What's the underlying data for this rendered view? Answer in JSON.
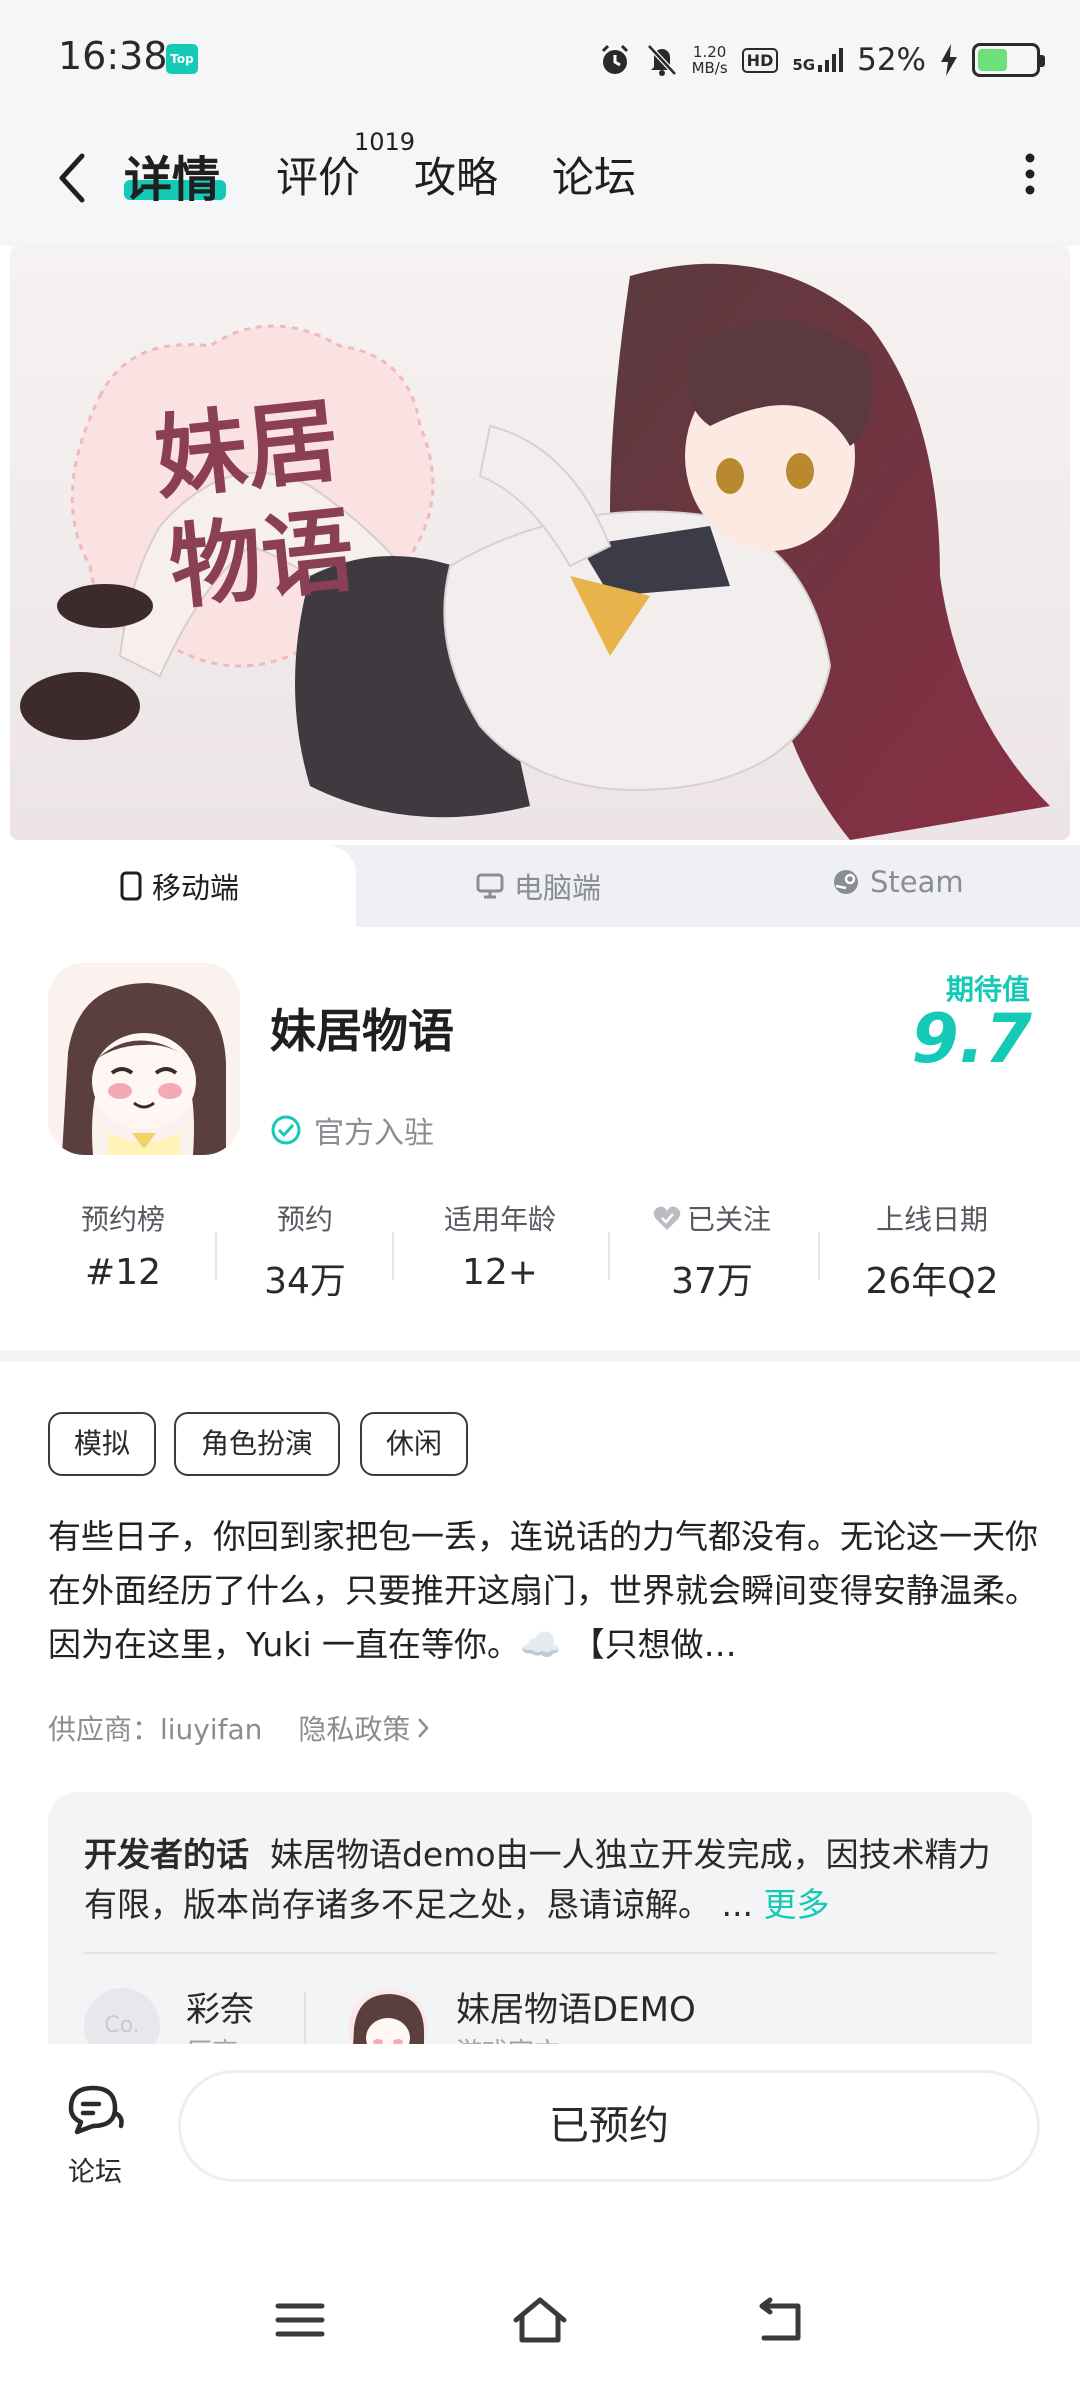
{
  "status_bar": {
    "time": "16:38",
    "top_badge": "Top",
    "net_speed_value": "1.20",
    "net_speed_unit": "MB/s",
    "hd_label": "HD",
    "signal_label": "5G",
    "battery_percent": "52%",
    "battery_level": 0.52,
    "icons": [
      "alarm-icon",
      "mute-icon",
      "signal-icon",
      "charging-icon",
      "battery-icon"
    ]
  },
  "nav": {
    "tabs": [
      {
        "label": "详情",
        "active": true
      },
      {
        "label": "评价",
        "count": "1019"
      },
      {
        "label": "攻略"
      },
      {
        "label": "论坛"
      }
    ]
  },
  "platform_tabs": [
    {
      "label": "移动端",
      "icon": "phone-icon",
      "active": true
    },
    {
      "label": "电脑端",
      "icon": "monitor-icon"
    },
    {
      "label": "Steam",
      "icon": "steam-icon"
    }
  ],
  "banner": {
    "logo_line1": "妹居",
    "logo_line2": "物语"
  },
  "app": {
    "name": "妹居物语",
    "official_label": "官方入驻",
    "expect_label": "期待值",
    "expect_score": "9.7"
  },
  "stats": [
    {
      "label": "预约榜",
      "value": "#12"
    },
    {
      "label": "预约",
      "value": "34万"
    },
    {
      "label": "适用年龄",
      "value": "12+"
    },
    {
      "label": "已关注",
      "value": "37万"
    },
    {
      "label": "上线日期",
      "value": "26年Q2"
    }
  ],
  "tags": [
    "模拟",
    "角色扮演",
    "休闲"
  ],
  "description": "有些日子，你回到家把包一丢，连说话的力气都没有。无论这一天你在外面经历了什么，只要推开这扇门，世界就会瞬间变得安静温柔。因为在这里，Yuki 一直在等你。☁️ 【只想做…",
  "meta": {
    "provider_label": "供应商：liuyifan",
    "privacy_label": "隐私政策"
  },
  "developer": {
    "title": "开发者的话",
    "text": "妹居物语demo由一人独立开发完成，因技术精力有限，版本尚存诸多不足之处，恳请谅解。 ...",
    "more_label": "更多",
    "items": [
      {
        "name": "彩奈",
        "sub": "厂商",
        "avatar_text": "Co."
      },
      {
        "name": "妹居物语DEMO",
        "sub": "游戏官方"
      }
    ]
  },
  "bottom": {
    "forum_label": "论坛",
    "reserve_label": "已预约"
  },
  "colors": {
    "accent": "#14c9b6",
    "background": "#ffffff",
    "text": "#1f1f1f",
    "muted": "#8a8d92"
  }
}
